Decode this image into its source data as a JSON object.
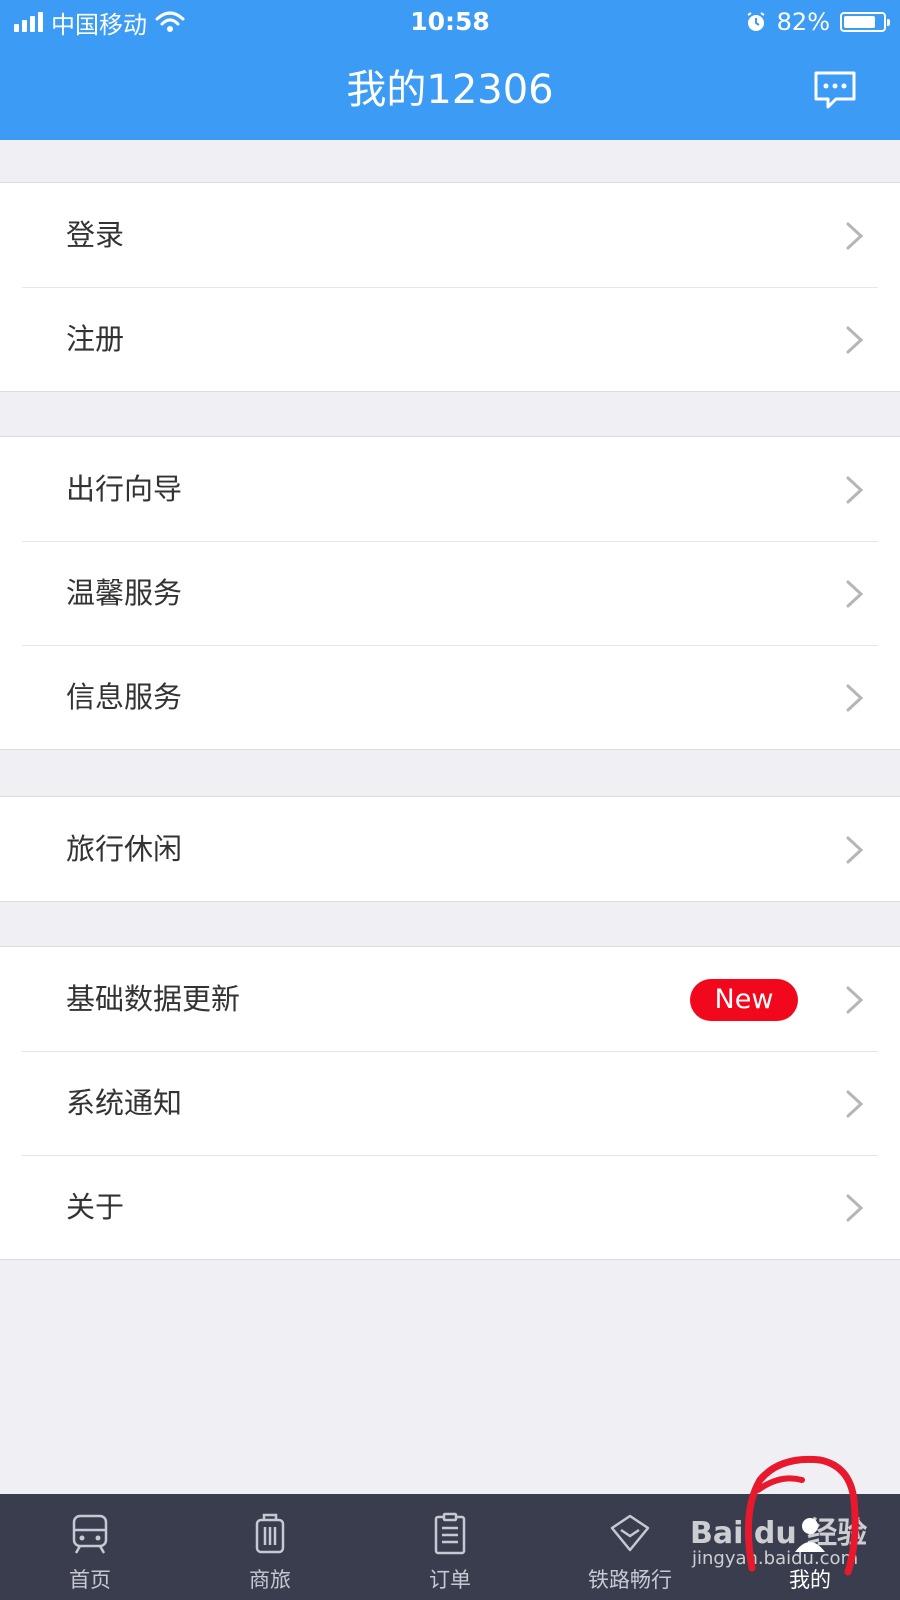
{
  "status": {
    "carrier": "中国移动",
    "time": "10:58",
    "battery": "82%",
    "battery_level": 0.82
  },
  "nav": {
    "title": "我的12306",
    "message_icon": "chat-bubble-icon"
  },
  "groups": [
    {
      "items": [
        {
          "label": "登录"
        },
        {
          "label": "注册"
        }
      ]
    },
    {
      "items": [
        {
          "label": "出行向导"
        },
        {
          "label": "温馨服务"
        },
        {
          "label": "信息服务"
        }
      ]
    },
    {
      "items": [
        {
          "label": "旅行休闲"
        }
      ]
    },
    {
      "items": [
        {
          "label": "基础数据更新",
          "badge": "New"
        },
        {
          "label": "系统通知"
        },
        {
          "label": "关于"
        }
      ]
    }
  ],
  "tabbar": {
    "tabs": [
      {
        "label": "首页",
        "icon": "train-icon"
      },
      {
        "label": "商旅",
        "icon": "luggage-icon"
      },
      {
        "label": "订单",
        "icon": "clipboard-icon"
      },
      {
        "label": "铁路畅行",
        "icon": "diamond-icon"
      },
      {
        "label": "我的",
        "icon": "profile-icon",
        "active": true
      }
    ]
  },
  "watermark": {
    "main": "Bai du 经验",
    "sub": "jingyan.baidu.com"
  },
  "colors": {
    "primary": "#3c9bf5",
    "badge": "#f2081c",
    "tabbar": "#3a3d4d",
    "background": "#efeff4"
  }
}
